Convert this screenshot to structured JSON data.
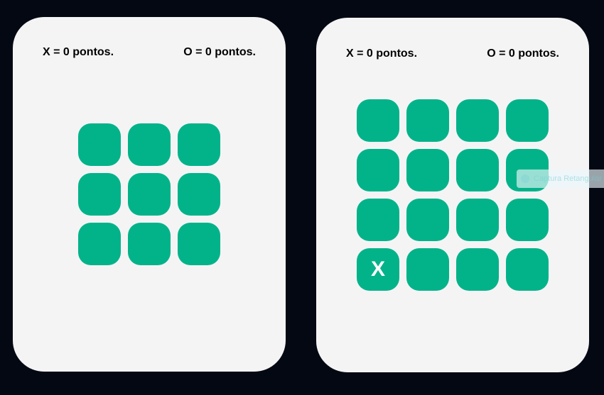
{
  "boards": [
    {
      "id": "classic",
      "score_x": "X = 0 pontos.",
      "score_o": "O = 0 pontos.",
      "cells": [
        "",
        "",
        "",
        "",
        "",
        "",
        "",
        "",
        ""
      ]
    },
    {
      "id": "large",
      "score_x": "X = 0 pontos.",
      "score_o": "O = 0 pontos.",
      "cells": [
        "",
        "",
        "",
        "",
        "",
        "",
        "",
        "",
        "",
        "",
        "",
        "",
        "X",
        "",
        "",
        ""
      ]
    }
  ],
  "overlay": {
    "tooltip_text": "Captura Retangular"
  },
  "colors": {
    "background": "#040812",
    "card": "#f4f4f5",
    "cell": "#02b38a",
    "mark": "#ffffff"
  }
}
